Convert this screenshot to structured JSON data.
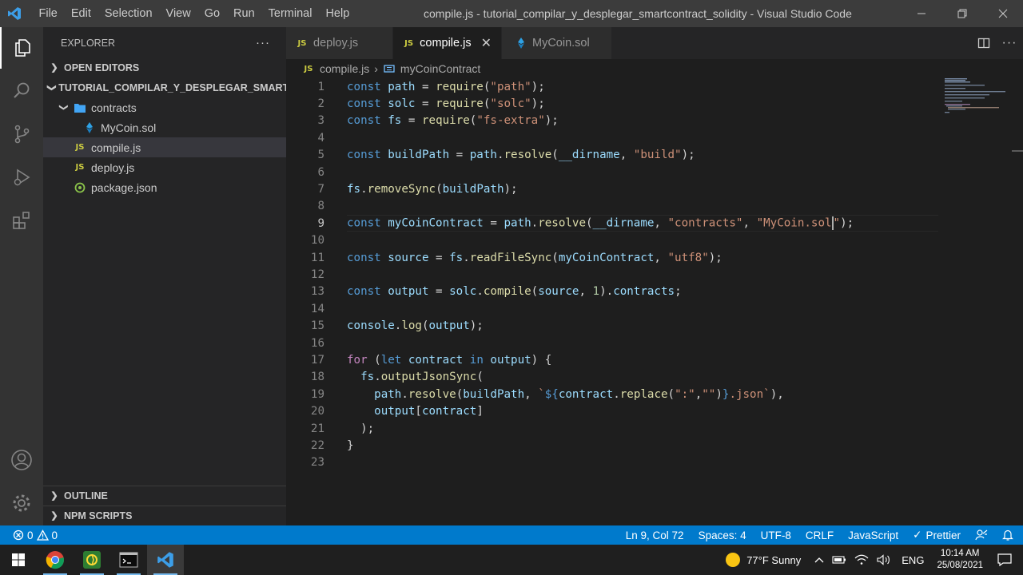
{
  "titlebar": {
    "menu": [
      "File",
      "Edit",
      "Selection",
      "View",
      "Go",
      "Run",
      "Terminal",
      "Help"
    ],
    "title": "compile.js - tutorial_compilar_y_desplegar_smartcontract_solidity - Visual Studio Code"
  },
  "sidebar": {
    "header": "EXPLORER",
    "open_editors": "OPEN EDITORS",
    "project": "TUTORIAL_COMPILAR_Y_DESPLEGAR_SMARTC...",
    "tree": {
      "folder": "contracts",
      "sol_file": "MyCoin.sol",
      "compile": "compile.js",
      "deploy": "deploy.js",
      "package": "package.json"
    },
    "outline": "OUTLINE",
    "npm_scripts": "NPM SCRIPTS"
  },
  "tabs": [
    {
      "label": "deploy.js",
      "active": false
    },
    {
      "label": "compile.js",
      "active": true
    },
    {
      "label": "MyCoin.sol",
      "active": false
    }
  ],
  "breadcrumb": {
    "file": "compile.js",
    "symbol": "myCoinContract"
  },
  "editor": {
    "current_line": 9,
    "line_numbers": [
      "1",
      "2",
      "3",
      "4",
      "5",
      "6",
      "7",
      "8",
      "9",
      "10",
      "11",
      "12",
      "13",
      "14",
      "15",
      "16",
      "17",
      "18",
      "19",
      "20",
      "21",
      "22",
      "23"
    ]
  },
  "statusbar": {
    "errors": "0",
    "warnings": "0",
    "position": "Ln 9, Col 72",
    "spaces": "Spaces: 4",
    "encoding": "UTF-8",
    "eol": "CRLF",
    "language": "JavaScript",
    "prettier": "Prettier"
  },
  "taskbar": {
    "weather": "77°F  Sunny",
    "lang": "ENG",
    "time": "10:14 AM",
    "date": "25/08/2021"
  },
  "colors": {
    "accent": "#007acc",
    "keyword": "#569cd6",
    "string": "#ce9178",
    "function": "#dcdcaa",
    "variable": "#9cdcfe"
  }
}
